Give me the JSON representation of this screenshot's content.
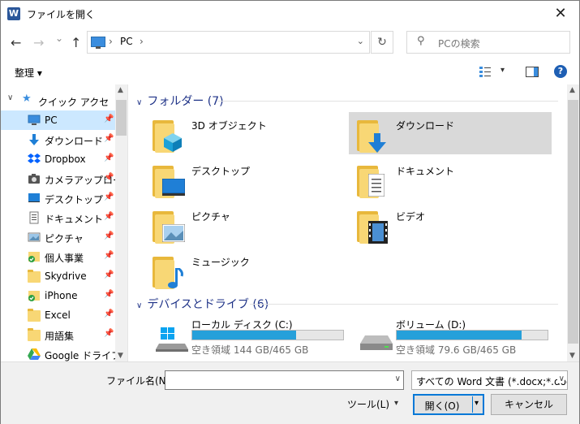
{
  "window": {
    "title": "ファイルを開く",
    "app_icon_letter": "W",
    "close_glyph": "✕"
  },
  "nav": {
    "back_glyph": "←",
    "forward_glyph": "→",
    "recent_glyph": "⌄",
    "up_glyph": "↑",
    "address": {
      "sep": "›",
      "crumb": "PC",
      "dropdown": "⌄"
    },
    "refresh_glyph": "↻",
    "search": {
      "icon_glyph": "⚲",
      "placeholder": "PCの検索"
    }
  },
  "toolbar": {
    "organize_label": "整理 ▾",
    "view_dd": "▾",
    "help": "?"
  },
  "sidebar": {
    "quick_access": {
      "chevron": "∨",
      "star": "★",
      "label": "クイック アクセス"
    },
    "pin": "📌",
    "items": [
      {
        "label": "PC",
        "icon": "pc-icon"
      },
      {
        "label": "ダウンロード",
        "icon": "download-icon"
      },
      {
        "label": "Dropbox",
        "icon": "dropbox-icon"
      },
      {
        "label": "カメラアップロー",
        "icon": "camera-folder-icon"
      },
      {
        "label": "デスクトップ",
        "icon": "desktop-icon"
      },
      {
        "label": "ドキュメント",
        "icon": "documents-icon"
      },
      {
        "label": "ピクチャ",
        "icon": "pictures-icon"
      },
      {
        "label": "個人事業",
        "icon": "synced-folder-icon"
      },
      {
        "label": "Skydrive",
        "icon": "folder-icon"
      },
      {
        "label": "iPhone",
        "icon": "synced-folder-icon"
      },
      {
        "label": "Excel",
        "icon": "folder-icon"
      },
      {
        "label": "用語集",
        "icon": "folder-icon"
      },
      {
        "label": "Google ドライブ",
        "icon": "google-drive-icon"
      }
    ]
  },
  "content": {
    "folders_header": "フォルダー (7)",
    "folders": [
      {
        "label": "3D オブジェクト",
        "icon": "3d-objects-folder-icon"
      },
      {
        "label": "ダウンロード",
        "icon": "downloads-folder-icon"
      },
      {
        "label": "デスクトップ",
        "icon": "desktop-folder-icon"
      },
      {
        "label": "ドキュメント",
        "icon": "documents-folder-icon"
      },
      {
        "label": "ピクチャ",
        "icon": "pictures-folder-icon"
      },
      {
        "label": "ビデオ",
        "icon": "videos-folder-icon"
      },
      {
        "label": "ミュージック",
        "icon": "music-folder-icon"
      }
    ],
    "drives_header": "デバイスとドライブ (6)",
    "drives": [
      {
        "name": "ローカル ディスク (C:)",
        "free": "空き領域 144 GB/465 GB",
        "used_fraction": 0.69,
        "icon": "windows-drive-icon"
      },
      {
        "name": "ボリューム (D:)",
        "free": "空き領域 79.6 GB/465 GB",
        "used_fraction": 0.83,
        "icon": "hard-drive-icon"
      }
    ]
  },
  "footer": {
    "filename_label": "ファイル名(N):",
    "filename_value": "",
    "filter_value": "すべての Word 文書 (*.docx;*.docm;*.dotx)",
    "tools_label": "ツール(L)",
    "open_label": "開く(O)",
    "cancel_label": "キャンセル",
    "dd": "▾"
  },
  "colors": {
    "accent": "#0078d7",
    "selection": "#cce8ff",
    "header_blue": "#1e3287",
    "bar_fill": "#26a0da"
  }
}
